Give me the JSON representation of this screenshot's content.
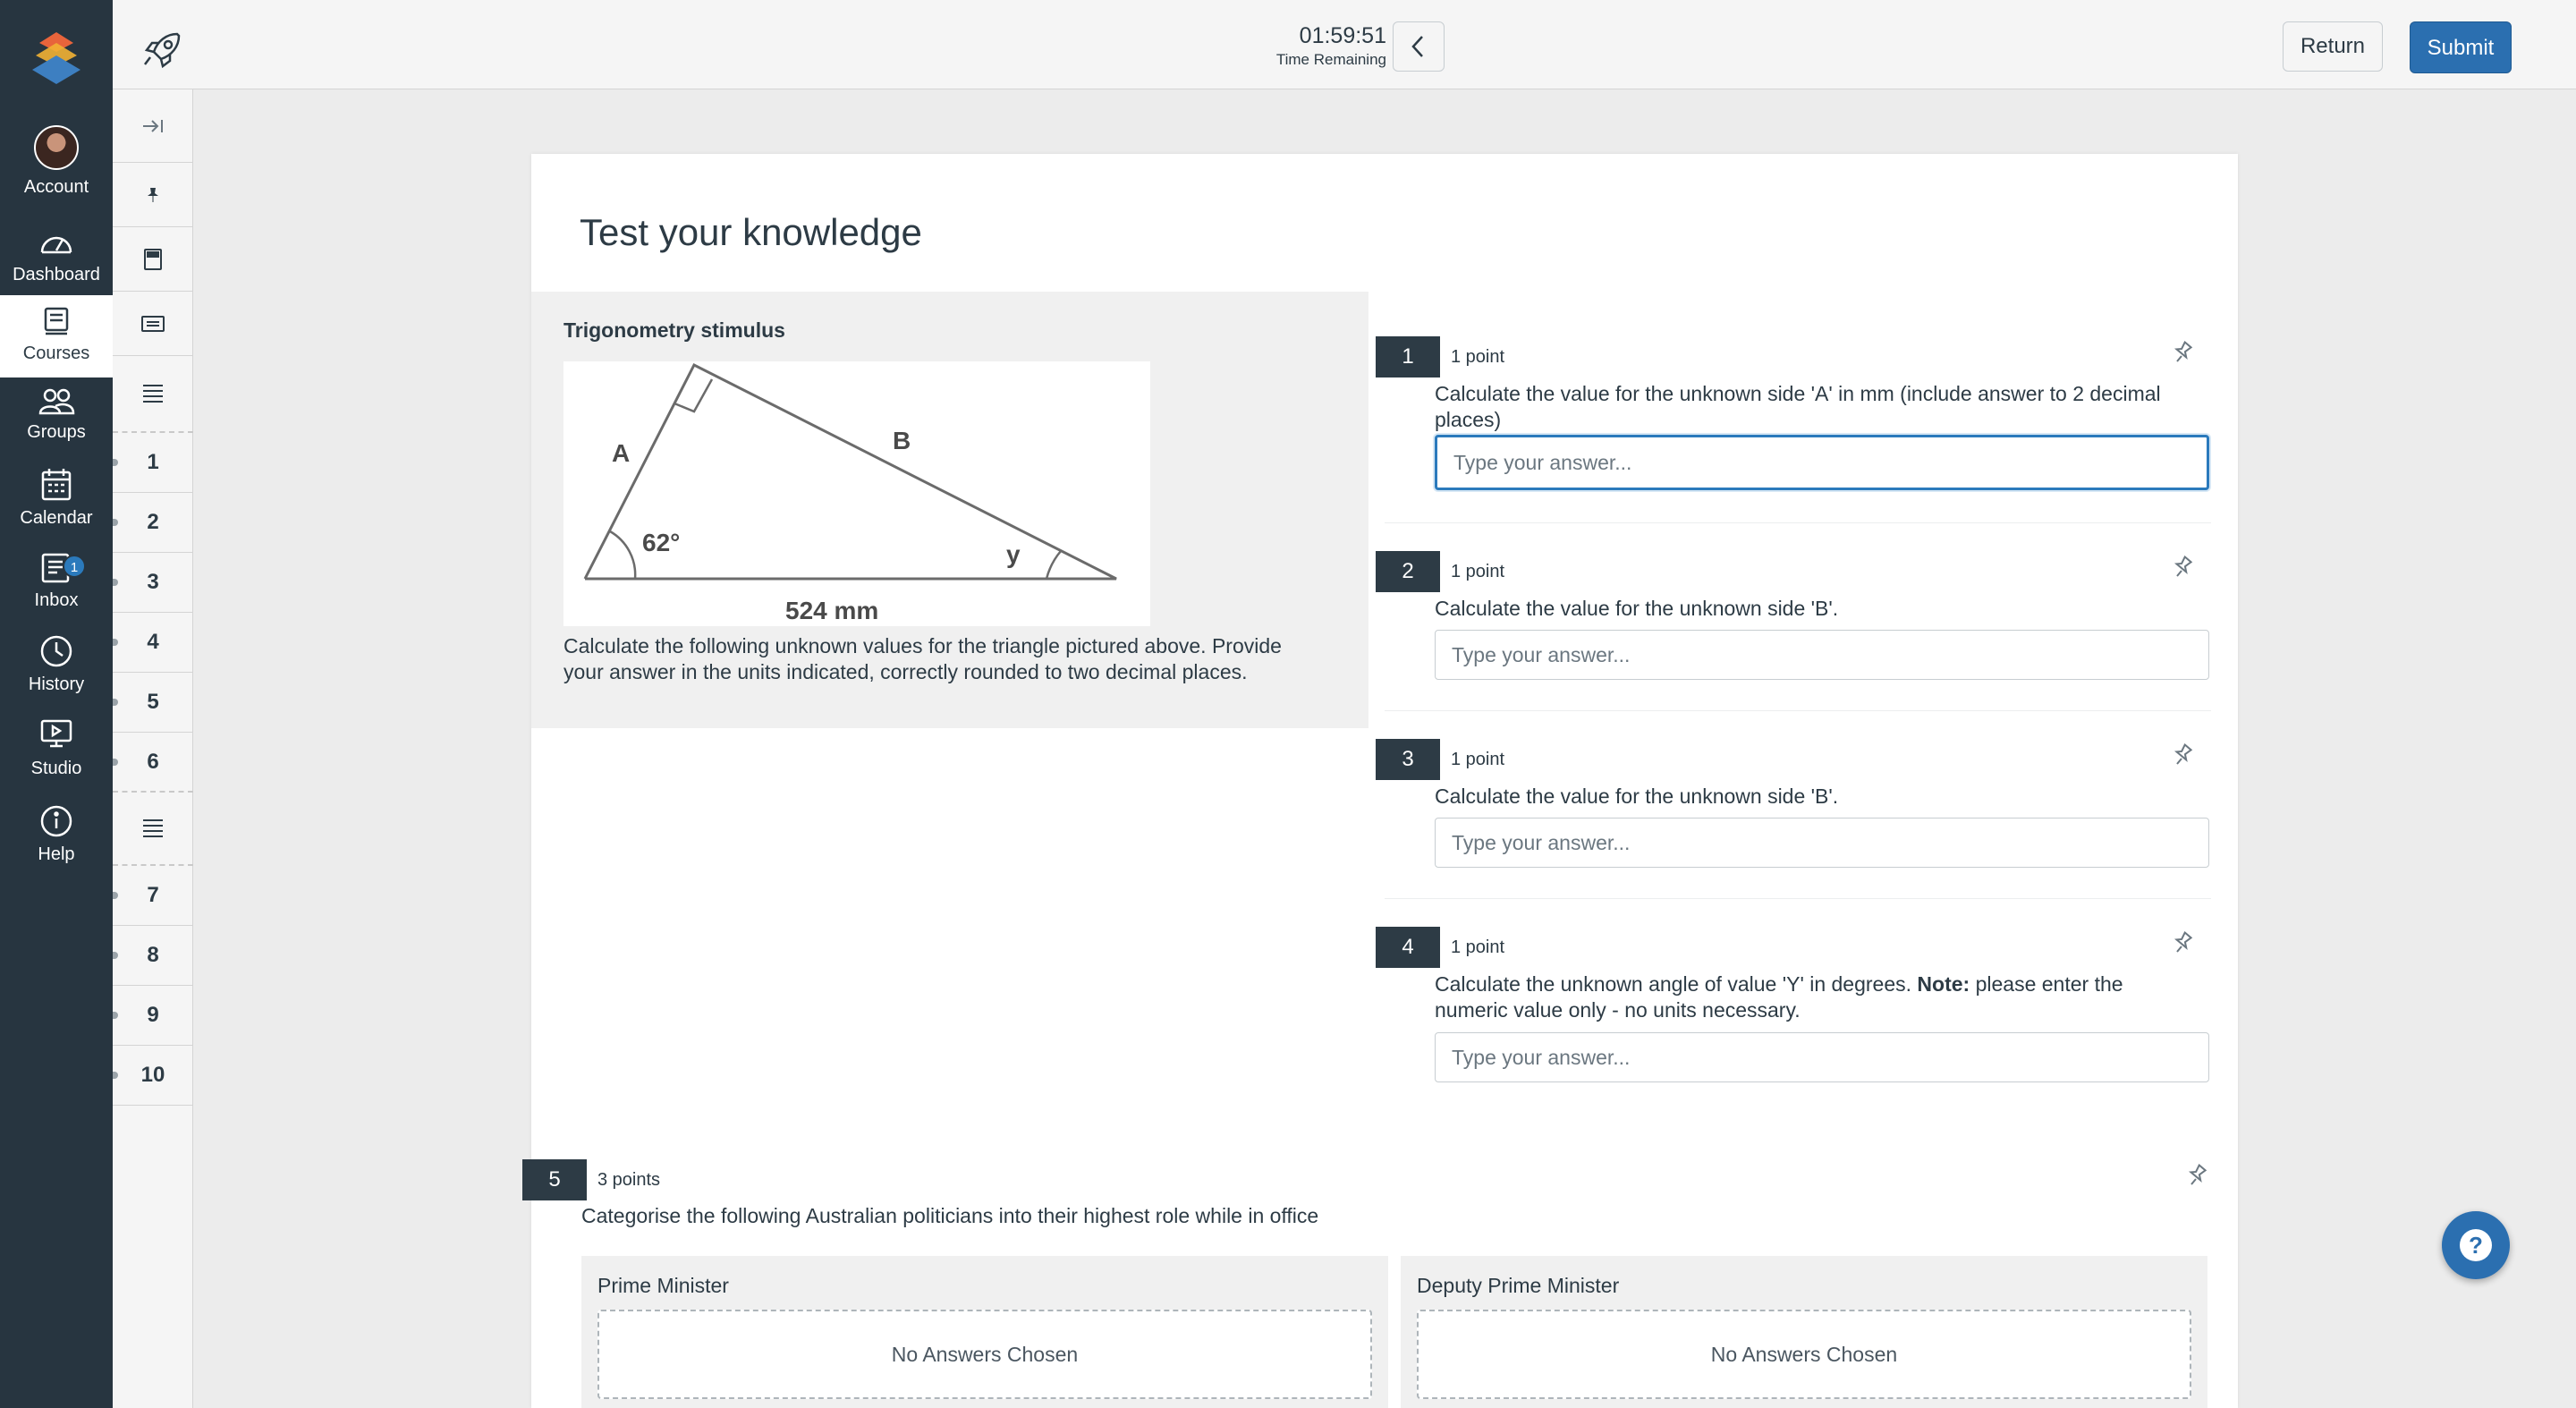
{
  "nav": {
    "items": [
      {
        "key": "account",
        "label": "Account",
        "icon": "avatar"
      },
      {
        "key": "dashboard",
        "label": "Dashboard",
        "icon": "dashboard-icon"
      },
      {
        "key": "courses",
        "label": "Courses",
        "icon": "courses-icon",
        "active": true
      },
      {
        "key": "groups",
        "label": "Groups",
        "icon": "groups-icon"
      },
      {
        "key": "calendar",
        "label": "Calendar",
        "icon": "calendar-icon"
      },
      {
        "key": "inbox",
        "label": "Inbox",
        "icon": "inbox-icon",
        "badge": "1"
      },
      {
        "key": "history",
        "label": "History",
        "icon": "history-icon"
      },
      {
        "key": "studio",
        "label": "Studio",
        "icon": "studio-icon"
      },
      {
        "key": "help",
        "label": "Help",
        "icon": "help-icon"
      }
    ]
  },
  "topbar": {
    "time": "01:59:51",
    "time_label": "Time Remaining",
    "return_label": "Return",
    "submit_label": "Submit"
  },
  "side_nav": {
    "numbers": [
      "1",
      "2",
      "3",
      "4",
      "5",
      "6",
      "7",
      "8",
      "9",
      "10"
    ]
  },
  "quiz": {
    "title": "Test your knowledge",
    "stimulus": {
      "title": "Trigonometry stimulus",
      "figure": {
        "label_a": "A",
        "label_b": "B",
        "angle": "62°",
        "label_y": "y",
        "base": "524 mm"
      },
      "text": "Calculate the following unknown values for the triangle pictured above. Provide your answer in the units indicated, correctly rounded to two decimal places."
    },
    "questions": [
      {
        "number": "1",
        "points": "1 point",
        "text": "Calculate the value for the unknown side 'A' in mm (include answer to 2 decimal places)",
        "placeholder": "Type your answer..."
      },
      {
        "number": "2",
        "points": "1 point",
        "text": "Calculate the value for the unknown side 'B'.",
        "placeholder": "Type your answer..."
      },
      {
        "number": "3",
        "points": "1 point",
        "text": "Calculate the value for the unknown side 'B'.",
        "placeholder": "Type your answer..."
      },
      {
        "number": "4",
        "points": "1 point",
        "text_before": "Calculate the unknown angle of value 'Y' in degrees. ",
        "text_bold": "Note:",
        "text_after": " please enter the numeric value only - no units necessary.",
        "placeholder": "Type your answer..."
      }
    ],
    "q5": {
      "number": "5",
      "points": "3 points",
      "text": "Categorise the following Australian politicians into their highest role while in office",
      "categories": [
        {
          "label": "Prime Minister",
          "empty": "No Answers Chosen"
        },
        {
          "label": "Deputy Prime Minister",
          "empty": "No Answers Chosen"
        }
      ]
    }
  },
  "colors": {
    "nav_bg": "#273540",
    "primary": "#2b6fb0",
    "question_badge": "#2d3b45"
  }
}
